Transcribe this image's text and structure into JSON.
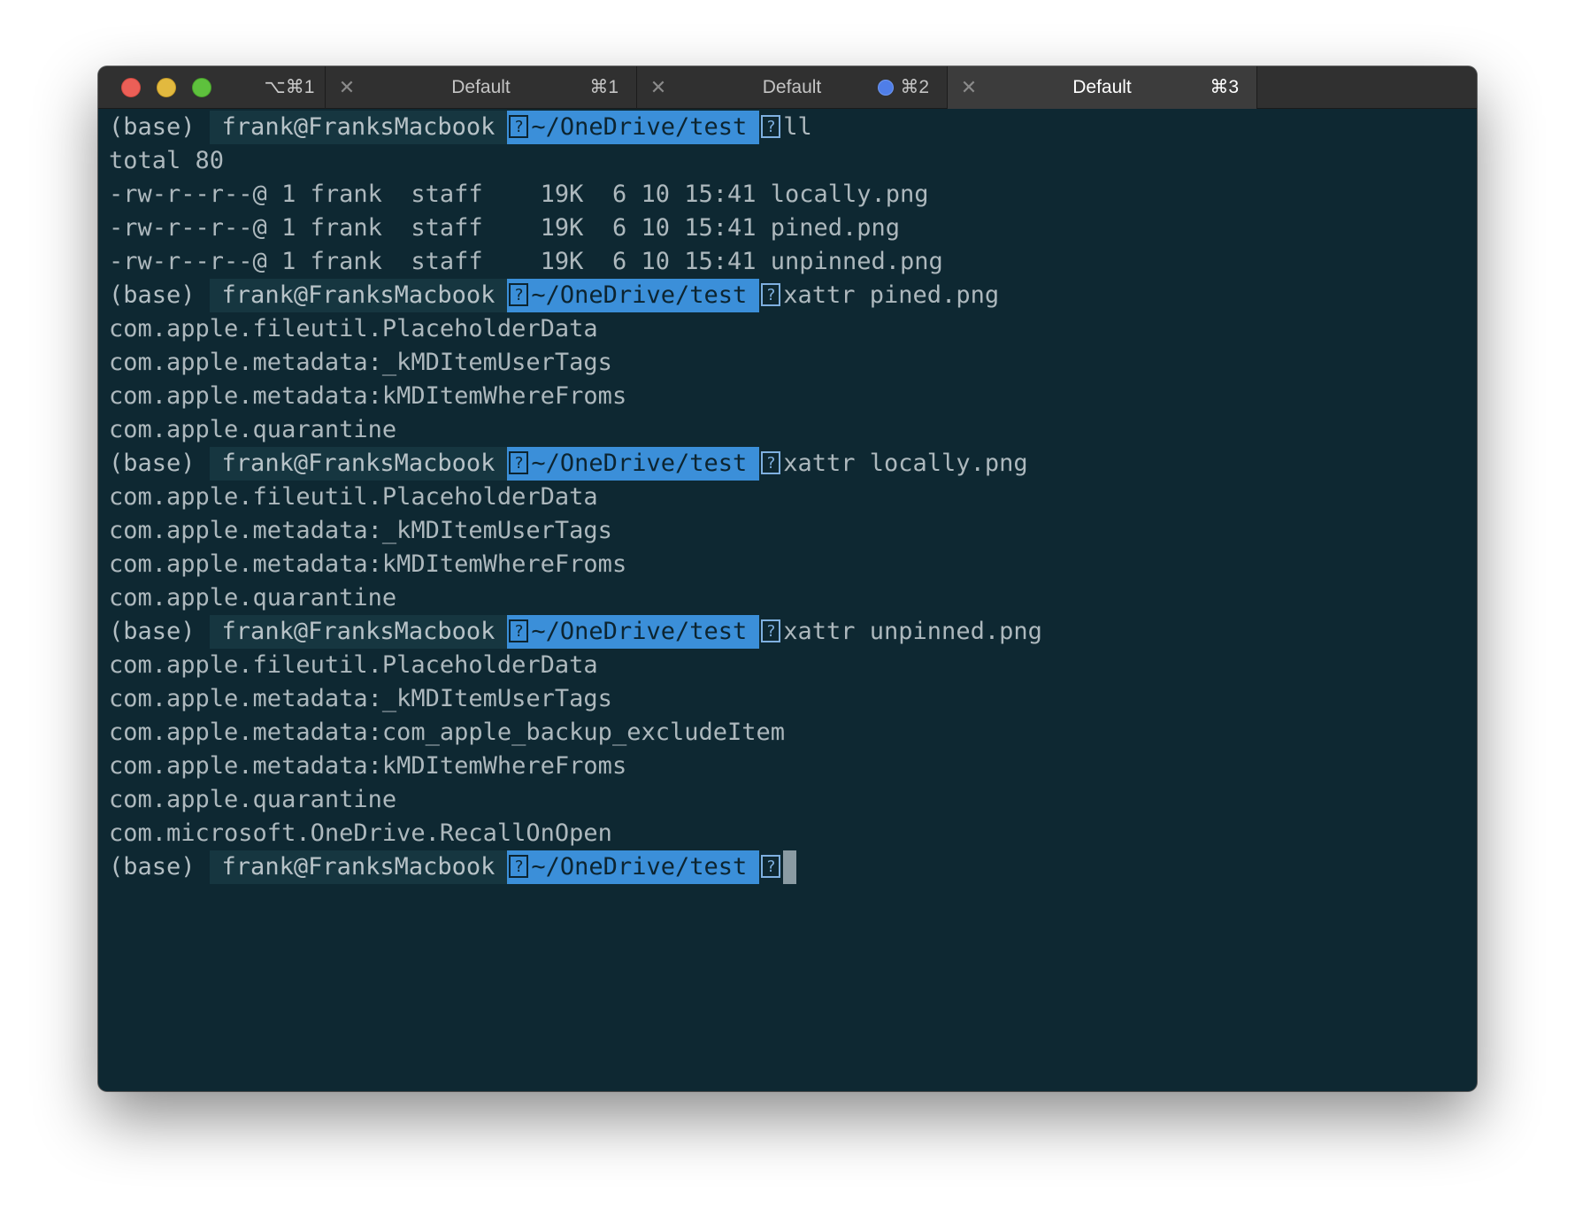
{
  "window": {
    "all_tabs_shortcut": "⌥⌘1",
    "tabs": [
      {
        "title": "Default",
        "shortcut": "⌘1",
        "active": false,
        "activity_dot": false
      },
      {
        "title": "Default",
        "shortcut": "⌘2",
        "active": false,
        "activity_dot": true
      },
      {
        "title": "Default",
        "shortcut": "⌘3",
        "active": true,
        "activity_dot": false
      }
    ],
    "colors": {
      "background": "#0e2832",
      "path_segment": "#3b8fd9",
      "activity_dot": "#4f7ee8"
    }
  },
  "prompt": {
    "env": "(base)",
    "user_host": "frank@FranksMacbook",
    "glyph": "?",
    "path": "~/OneDrive/test"
  },
  "terminal": {
    "lines": [
      {
        "type": "prompt",
        "command": "ll"
      },
      {
        "type": "output",
        "text": "total 80"
      },
      {
        "type": "output",
        "text": "-rw-r--r--@ 1 frank  staff    19K  6 10 15:41 locally.png"
      },
      {
        "type": "output",
        "text": "-rw-r--r--@ 1 frank  staff    19K  6 10 15:41 pined.png"
      },
      {
        "type": "output",
        "text": "-rw-r--r--@ 1 frank  staff    19K  6 10 15:41 unpinned.png"
      },
      {
        "type": "prompt",
        "command": "xattr pined.png"
      },
      {
        "type": "output",
        "text": "com.apple.fileutil.PlaceholderData"
      },
      {
        "type": "output",
        "text": "com.apple.metadata:_kMDItemUserTags"
      },
      {
        "type": "output",
        "text": "com.apple.metadata:kMDItemWhereFroms"
      },
      {
        "type": "output",
        "text": "com.apple.quarantine"
      },
      {
        "type": "prompt",
        "command": "xattr locally.png"
      },
      {
        "type": "output",
        "text": "com.apple.fileutil.PlaceholderData"
      },
      {
        "type": "output",
        "text": "com.apple.metadata:_kMDItemUserTags"
      },
      {
        "type": "output",
        "text": "com.apple.metadata:kMDItemWhereFroms"
      },
      {
        "type": "output",
        "text": "com.apple.quarantine"
      },
      {
        "type": "prompt",
        "command": "xattr unpinned.png"
      },
      {
        "type": "output",
        "text": "com.apple.fileutil.PlaceholderData"
      },
      {
        "type": "output",
        "text": "com.apple.metadata:_kMDItemUserTags"
      },
      {
        "type": "output",
        "text": "com.apple.metadata:com_apple_backup_excludeItem"
      },
      {
        "type": "output",
        "text": "com.apple.metadata:kMDItemWhereFroms"
      },
      {
        "type": "output",
        "text": "com.apple.quarantine"
      },
      {
        "type": "output",
        "text": "com.microsoft.OneDrive.RecallOnOpen"
      },
      {
        "type": "prompt",
        "command": "",
        "cursor": true
      }
    ]
  }
}
